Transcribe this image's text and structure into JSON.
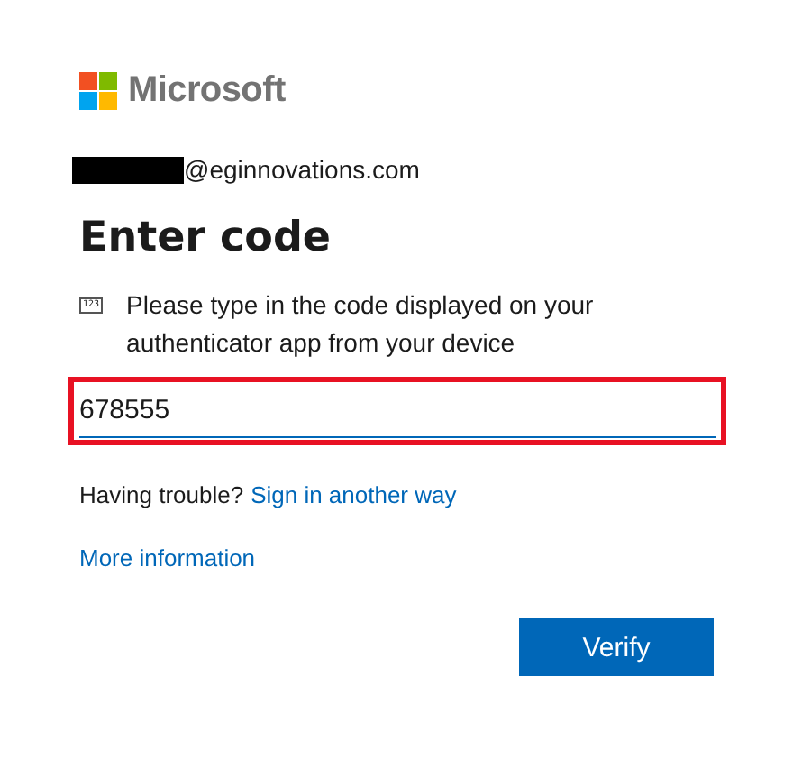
{
  "brand": {
    "name": "Microsoft"
  },
  "account": {
    "redacted": true,
    "email": "@eginnovations.com"
  },
  "title": "Enter code",
  "instruction": {
    "icon_text": "123",
    "text": "Please type in the code displayed on your authenticator app from your device"
  },
  "code_field": {
    "value": "678555",
    "highlighted": true
  },
  "trouble": {
    "text": "Having trouble?",
    "link": "Sign in another way"
  },
  "more_info": "More information",
  "buttons": [
    {
      "label": "Verify",
      "kind": "primary"
    }
  ]
}
